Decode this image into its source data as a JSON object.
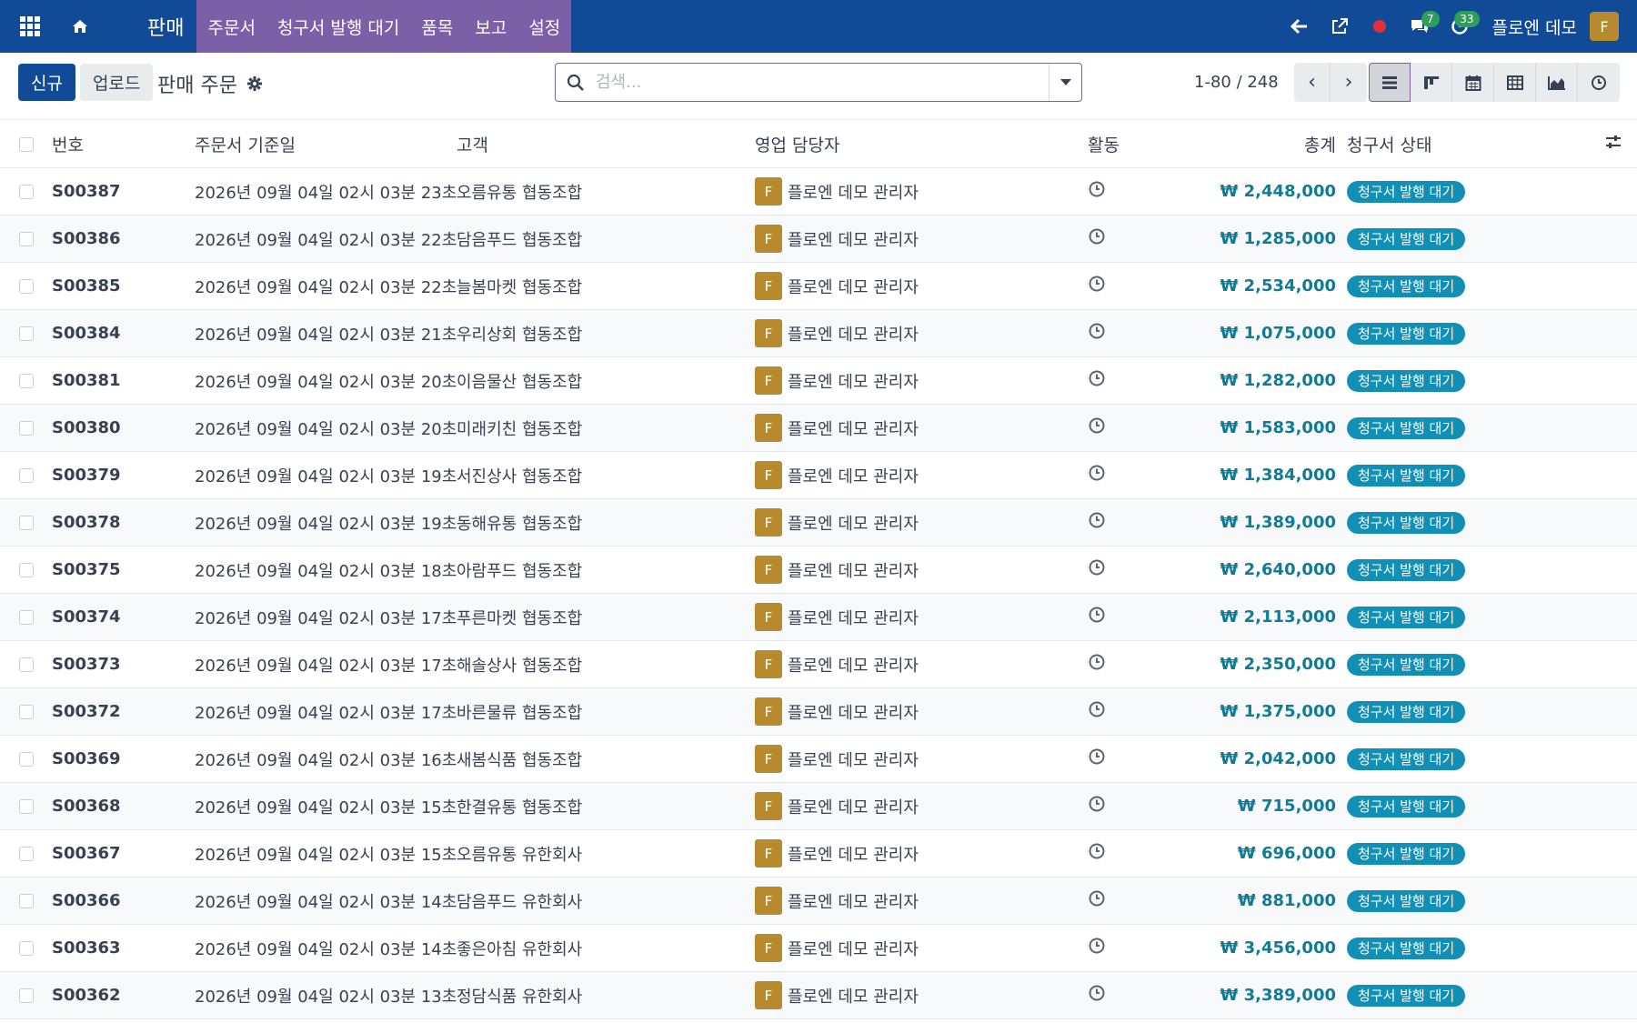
{
  "navbar": {
    "app_name": "판매",
    "menu": [
      "주문서",
      "청구서 발행 대기",
      "품목",
      "보고",
      "설정"
    ],
    "messages_count": "7",
    "activities_count": "33",
    "user_name": "플로엔 데모",
    "user_initial": "F"
  },
  "control": {
    "new_label": "신규",
    "upload_label": "업로드",
    "title": "판매 주문",
    "search_placeholder": "검색...",
    "pager": "1-80 / 248"
  },
  "table": {
    "headers": {
      "number": "번호",
      "date": "주문서 기준일",
      "customer": "고객",
      "salesperson": "영업 담당자",
      "activity": "활동",
      "total": "총계",
      "invoice_status": "청구서 상태"
    },
    "rows": [
      {
        "number": "S00387",
        "date": "2026년 09월 04일 02시 03분 23초",
        "customer": "오름유통 협동조합",
        "rep": "플로엔 데모 관리자",
        "rep_initial": "F",
        "total": "₩ 2,448,000",
        "status": "청구서 발행 대기"
      },
      {
        "number": "S00386",
        "date": "2026년 09월 04일 02시 03분 22초",
        "customer": "담음푸드 협동조합",
        "rep": "플로엔 데모 관리자",
        "rep_initial": "F",
        "total": "₩ 1,285,000",
        "status": "청구서 발행 대기"
      },
      {
        "number": "S00385",
        "date": "2026년 09월 04일 02시 03분 22초",
        "customer": "늘봄마켓 협동조합",
        "rep": "플로엔 데모 관리자",
        "rep_initial": "F",
        "total": "₩ 2,534,000",
        "status": "청구서 발행 대기"
      },
      {
        "number": "S00384",
        "date": "2026년 09월 04일 02시 03분 21초",
        "customer": "우리상회 협동조합",
        "rep": "플로엔 데모 관리자",
        "rep_initial": "F",
        "total": "₩ 1,075,000",
        "status": "청구서 발행 대기"
      },
      {
        "number": "S00381",
        "date": "2026년 09월 04일 02시 03분 20초",
        "customer": "이음물산 협동조합",
        "rep": "플로엔 데모 관리자",
        "rep_initial": "F",
        "total": "₩ 1,282,000",
        "status": "청구서 발행 대기"
      },
      {
        "number": "S00380",
        "date": "2026년 09월 04일 02시 03분 20초",
        "customer": "미래키친 협동조합",
        "rep": "플로엔 데모 관리자",
        "rep_initial": "F",
        "total": "₩ 1,583,000",
        "status": "청구서 발행 대기"
      },
      {
        "number": "S00379",
        "date": "2026년 09월 04일 02시 03분 19초",
        "customer": "서진상사 협동조합",
        "rep": "플로엔 데모 관리자",
        "rep_initial": "F",
        "total": "₩ 1,384,000",
        "status": "청구서 발행 대기"
      },
      {
        "number": "S00378",
        "date": "2026년 09월 04일 02시 03분 19초",
        "customer": "동해유통 협동조합",
        "rep": "플로엔 데모 관리자",
        "rep_initial": "F",
        "total": "₩ 1,389,000",
        "status": "청구서 발행 대기"
      },
      {
        "number": "S00375",
        "date": "2026년 09월 04일 02시 03분 18초",
        "customer": "아람푸드 협동조합",
        "rep": "플로엔 데모 관리자",
        "rep_initial": "F",
        "total": "₩ 2,640,000",
        "status": "청구서 발행 대기"
      },
      {
        "number": "S00374",
        "date": "2026년 09월 04일 02시 03분 17초",
        "customer": "푸른마켓 협동조합",
        "rep": "플로엔 데모 관리자",
        "rep_initial": "F",
        "total": "₩ 2,113,000",
        "status": "청구서 발행 대기"
      },
      {
        "number": "S00373",
        "date": "2026년 09월 04일 02시 03분 17초",
        "customer": "해솔상사 협동조합",
        "rep": "플로엔 데모 관리자",
        "rep_initial": "F",
        "total": "₩ 2,350,000",
        "status": "청구서 발행 대기"
      },
      {
        "number": "S00372",
        "date": "2026년 09월 04일 02시 03분 17초",
        "customer": "바른물류 협동조합",
        "rep": "플로엔 데모 관리자",
        "rep_initial": "F",
        "total": "₩ 1,375,000",
        "status": "청구서 발행 대기"
      },
      {
        "number": "S00369",
        "date": "2026년 09월 04일 02시 03분 16초",
        "customer": "새봄식품 협동조합",
        "rep": "플로엔 데모 관리자",
        "rep_initial": "F",
        "total": "₩ 2,042,000",
        "status": "청구서 발행 대기"
      },
      {
        "number": "S00368",
        "date": "2026년 09월 04일 02시 03분 15초",
        "customer": "한결유통 협동조합",
        "rep": "플로엔 데모 관리자",
        "rep_initial": "F",
        "total": "₩ 715,000",
        "status": "청구서 발행 대기"
      },
      {
        "number": "S00367",
        "date": "2026년 09월 04일 02시 03분 15초",
        "customer": "오름유통 유한회사",
        "rep": "플로엔 데모 관리자",
        "rep_initial": "F",
        "total": "₩ 696,000",
        "status": "청구서 발행 대기"
      },
      {
        "number": "S00366",
        "date": "2026년 09월 04일 02시 03분 14초",
        "customer": "담음푸드 유한회사",
        "rep": "플로엔 데모 관리자",
        "rep_initial": "F",
        "total": "₩ 881,000",
        "status": "청구서 발행 대기"
      },
      {
        "number": "S00363",
        "date": "2026년 09월 04일 02시 03분 14초",
        "customer": "좋은아침 유한회사",
        "rep": "플로엔 데모 관리자",
        "rep_initial": "F",
        "total": "₩ 3,456,000",
        "status": "청구서 발행 대기"
      },
      {
        "number": "S00362",
        "date": "2026년 09월 04일 02시 03분 13초",
        "customer": "정담식품 유한회사",
        "rep": "플로엔 데모 관리자",
        "rep_initial": "F",
        "total": "₩ 3,389,000",
        "status": "청구서 발행 대기"
      }
    ]
  },
  "colors": {
    "navbar": "#114a97",
    "menu_active": "#7b5fa7",
    "primary": "#114a97",
    "amount": "#0f7b97",
    "status_pill": "#128fb4",
    "avatar": "#b88a2e"
  },
  "icons": [
    "apps-grid-icon",
    "home-icon",
    "back-arrow-icon",
    "external-link-icon",
    "record-icon",
    "chat-icon",
    "activity-clock-icon",
    "gear-icon",
    "search-icon",
    "list-view-icon",
    "kanban-view-icon",
    "calendar-view-icon",
    "pivot-view-icon",
    "graph-view-icon",
    "activity-view-icon",
    "column-settings-icon"
  ]
}
